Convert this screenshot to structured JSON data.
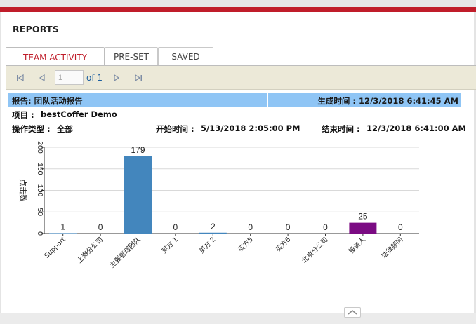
{
  "page": {
    "title": "REPORTS"
  },
  "tabs": [
    {
      "label": "TEAM ACTIVITY",
      "active": true
    },
    {
      "label": "PRE-SET",
      "active": false
    },
    {
      "label": "SAVED",
      "active": false
    }
  ],
  "pager": {
    "current_page": "1",
    "of_label": "of 1"
  },
  "report": {
    "title": "报告: 团队活动报告",
    "generated": "生成时间 : 12/3/2018 6:41:45 AM",
    "project_label": "项目 :",
    "project_value": "bestCoffer Demo",
    "op_type_label": "操作类型 :",
    "op_type_value": "全部",
    "start_label": "开始时间 :",
    "start_value": "5/13/2018 2:05:00 PM",
    "end_label": "结束时间 :",
    "end_value": "12/3/2018 6:41:00 AM"
  },
  "colors": {
    "accent": "#c01d2a",
    "header_blue": "#8fc5f5",
    "bar_blue": "#4386bd",
    "bar_purple": "#7b0b83"
  },
  "chart_data": {
    "type": "bar",
    "ylabel": "点击数",
    "ylim": [
      0,
      200
    ],
    "yticks": [
      0,
      50,
      100,
      150,
      200
    ],
    "grid": true,
    "categories": [
      "Support",
      "上海分公司",
      "主要管理团队",
      "买方 1",
      "买方 2",
      "买方5",
      "买方6",
      "北京分公司",
      "投资人",
      "法律顾问"
    ],
    "values": [
      1,
      0,
      179,
      0,
      2,
      0,
      0,
      0,
      25,
      0
    ],
    "colors": [
      "#4386bd",
      "#4386bd",
      "#4386bd",
      "#4386bd",
      "#4386bd",
      "#4386bd",
      "#4386bd",
      "#4386bd",
      "#7b0b83",
      "#4386bd"
    ]
  }
}
